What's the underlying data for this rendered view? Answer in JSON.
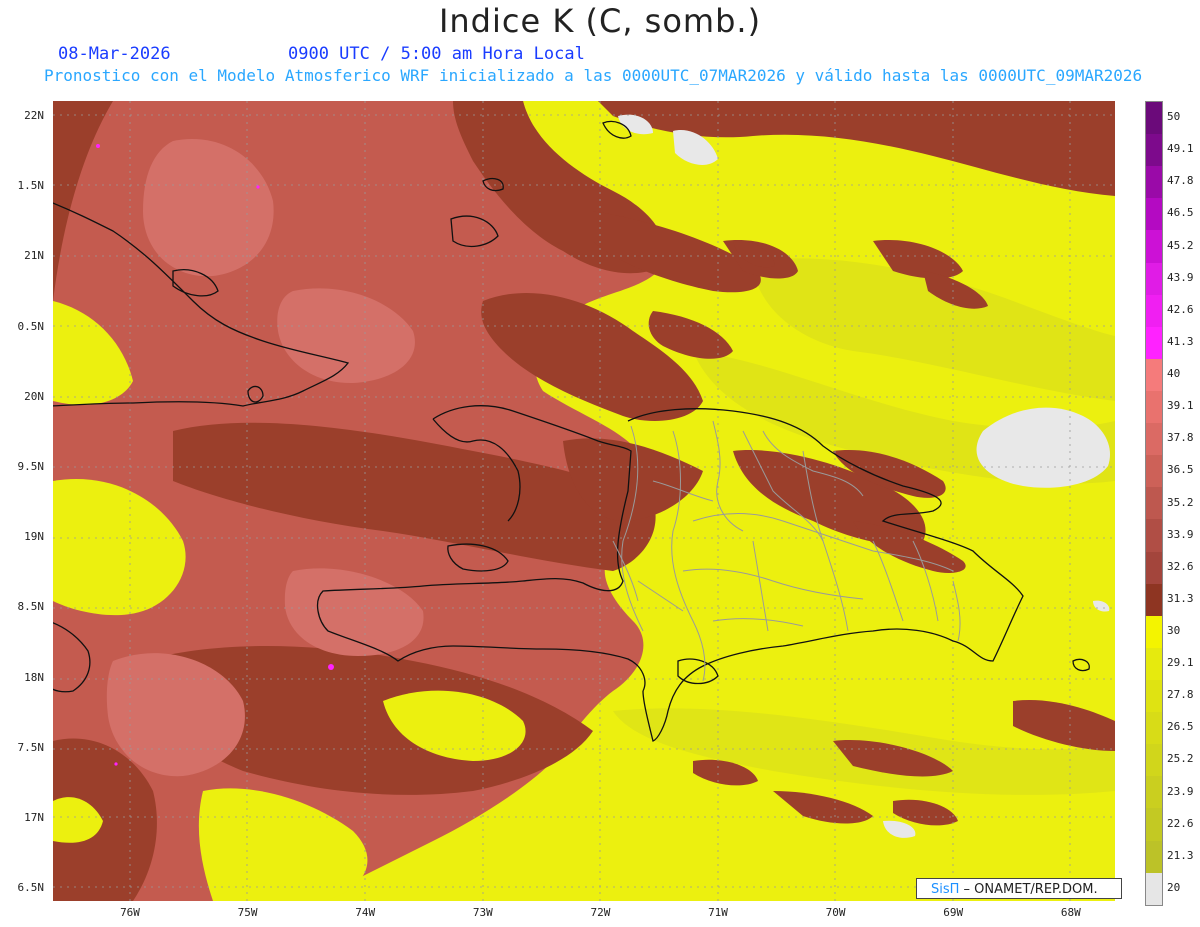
{
  "title": "Indice K (C, somb.)",
  "date": "08-Mar-2026",
  "time_line": "0900 UTC / 5:00 am Hora Local",
  "description": "Pronostico con el Modelo Atmosferico WRF inicializado a las 0000UTC_07MAR2026 y válido hasta las  0000UTC_09MAR2026",
  "credit": {
    "brand": "SisΠ",
    "org": " – ONAMET/REP.DOM."
  },
  "lat_labels": [
    "22N",
    "1.5N",
    "21N",
    "0.5N",
    "20N",
    "9.5N",
    "19N",
    "8.5N",
    "18N",
    "7.5N",
    "17N",
    "6.5N"
  ],
  "lon_labels": [
    "76W",
    "75W",
    "74W",
    "73W",
    "72W",
    "71W",
    "70W",
    "69W",
    "68W"
  ],
  "colorbar": {
    "labels": [
      "50",
      "49.1",
      "47.8",
      "46.5",
      "45.2",
      "43.9",
      "42.6",
      "41.3",
      "40",
      "39.1",
      "37.8",
      "36.5",
      "35.2",
      "33.9",
      "32.6",
      "31.3",
      "30",
      "29.1",
      "27.8",
      "26.5",
      "25.2",
      "23.9",
      "22.6",
      "21.3",
      "20"
    ],
    "colors": [
      "#6b0a7a",
      "#7d0a8c",
      "#9a0aa8",
      "#b40ac2",
      "#cc11d6",
      "#e01ce6",
      "#f01ff2",
      "#ff22ff",
      "#f57b7b",
      "#e9726e",
      "#db6a64",
      "#cd6158",
      "#be584f",
      "#b04e45",
      "#a3453c",
      "#8e3522",
      "#f4f400",
      "#e6ea0e",
      "#dfe312",
      "#d8dc17",
      "#d1d61b",
      "#cacf1f",
      "#c3c923",
      "#bcc228",
      "#e6e6e6"
    ]
  },
  "palette": {
    "land_dark": "#9b3f2b",
    "land_mid": "#c45b4f",
    "land_light": "#d47068",
    "yellow": "#ecf00f",
    "yellow_dim": "#d9dc1a",
    "low": "#e8e8e8",
    "coast": "#111111",
    "provinces": "#9a9a9a"
  }
}
